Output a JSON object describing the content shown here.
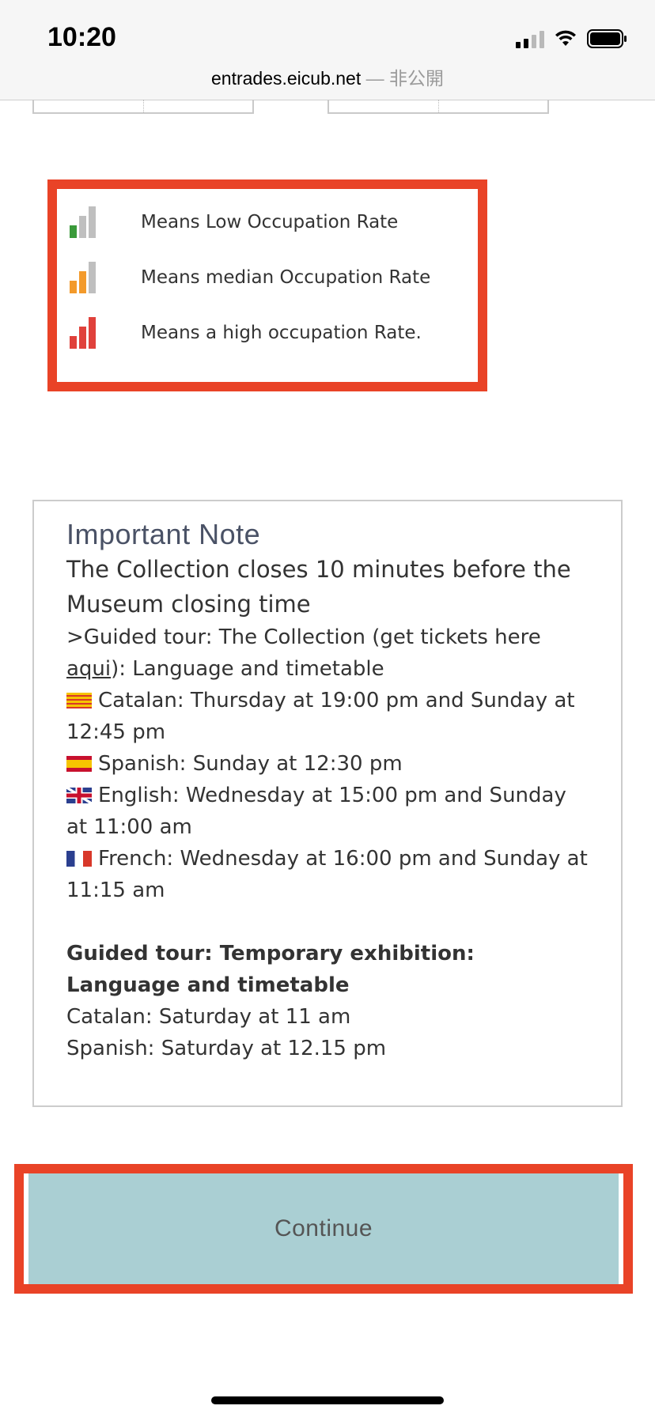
{
  "status_bar": {
    "time": "10:20"
  },
  "browser": {
    "domain": "entrades.eicub.net",
    "suffix": "— 非公開"
  },
  "legend": {
    "items": [
      {
        "label": "Means Low Occupation Rate",
        "level": 1,
        "active_color": "#3a9a3a"
      },
      {
        "label": "Means median Occupation Rate",
        "level": 2,
        "active_color": "#f39a2b"
      },
      {
        "label": "Means a high occupation Rate.",
        "level": 3,
        "active_color": "#e0413b"
      }
    ],
    "inactive_color": "#bfbfbf"
  },
  "note": {
    "title": "Important Note",
    "subtitle": "The Collection closes 10 minutes before the Museum closing time",
    "guided_intro_before": ">Guided tour: The Collection (get tickets here ",
    "guided_intro_link": "aqui",
    "guided_intro_after": "): Language and timetable",
    "languages": [
      {
        "flag": "catalan-flag",
        "text": "Catalan: Thursday at 19:00 pm and Sunday at 12:45 pm"
      },
      {
        "flag": "spain-flag",
        "text": "Spanish: Sunday at 12:30 pm"
      },
      {
        "flag": "uk-flag",
        "text": "English: Wednesday at 15:00 pm and Sunday at 11:00 am"
      },
      {
        "flag": "france-flag",
        "text": "French: Wednesday at 16:00 pm and Sunday at 11:15 am"
      }
    ],
    "temporary_heading": "Guided tour: Temporary exhibition: Language and timetable",
    "temporary_lines": [
      "Catalan: Saturday at 11 am",
      "Spanish: Saturday at 12.15 pm"
    ]
  },
  "continue_button": {
    "label": "Continue"
  },
  "colors": {
    "highlight": "#e94327",
    "button": "#aacfd3"
  }
}
